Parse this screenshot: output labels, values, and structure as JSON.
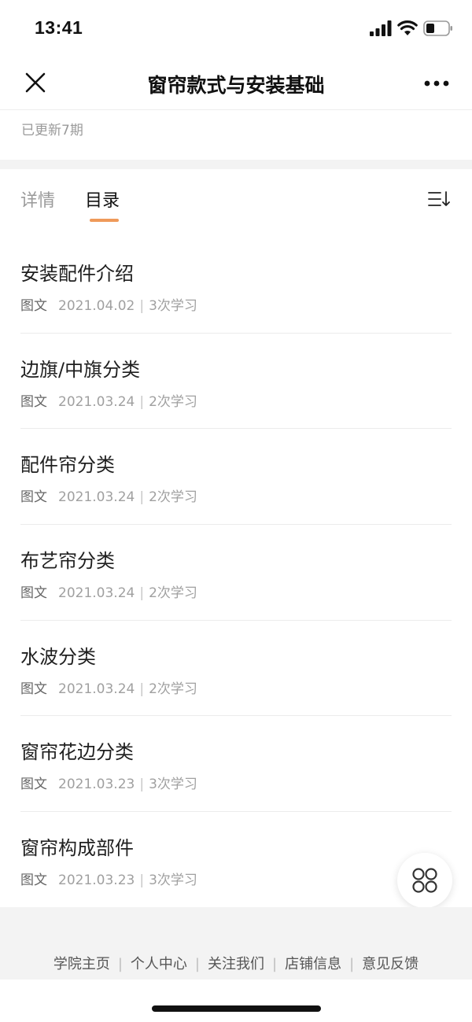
{
  "status_bar": {
    "time": "13:41"
  },
  "nav": {
    "title": "窗帘款式与安装基础"
  },
  "course": {
    "update_text": "已更新7期"
  },
  "tabs": [
    {
      "label": "详情",
      "active": false
    },
    {
      "label": "目录",
      "active": true
    }
  ],
  "items": [
    {
      "title": "安装配件介绍",
      "type": "图文",
      "date": "2021.04.02",
      "views": "3次学习"
    },
    {
      "title": "边旗/中旗分类",
      "type": "图文",
      "date": "2021.03.24",
      "views": "2次学习"
    },
    {
      "title": "配件帘分类",
      "type": "图文",
      "date": "2021.03.24",
      "views": "2次学习"
    },
    {
      "title": "布艺帘分类",
      "type": "图文",
      "date": "2021.03.24",
      "views": "2次学习"
    },
    {
      "title": "水波分类",
      "type": "图文",
      "date": "2021.03.24",
      "views": "2次学习"
    },
    {
      "title": "窗帘花边分类",
      "type": "图文",
      "date": "2021.03.23",
      "views": "3次学习"
    },
    {
      "title": "窗帘构成部件",
      "type": "图文",
      "date": "2021.03.23",
      "views": "3次学习"
    }
  ],
  "footer": {
    "links": [
      "学院主页",
      "个人中心",
      "关注我们",
      "店铺信息",
      "意见反馈"
    ]
  },
  "colors": {
    "accent": "#ef9a5a",
    "footer_bg": "#f3f3f3"
  }
}
